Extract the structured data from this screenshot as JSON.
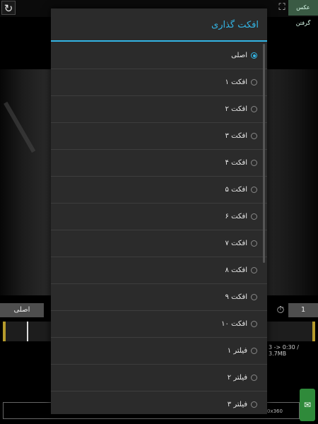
{
  "topbar": {
    "refresh_icon": "↻",
    "fullscreen_icon": "⛶",
    "photo_button": "عکس گرفتن"
  },
  "controls": {
    "original_button": "اصلی",
    "timer_icon": "⏱",
    "count_value": "1",
    "info_text": "3 -> 0:30 / 3.7MB",
    "resolution_text": "0x360"
  },
  "dialog": {
    "title": "افکت گذاری",
    "selected_index": 0,
    "options": [
      {
        "label": "اصلی"
      },
      {
        "label": "افکت ۱"
      },
      {
        "label": "افکت ۲"
      },
      {
        "label": "افکت ۳"
      },
      {
        "label": "افکت ۴"
      },
      {
        "label": "افکت ۵"
      },
      {
        "label": "افکت ۶"
      },
      {
        "label": "افکت ۷"
      },
      {
        "label": "افکت ۸"
      },
      {
        "label": "افکت ۹"
      },
      {
        "label": "افکت ۱۰"
      },
      {
        "label": "فیلتر ۱"
      },
      {
        "label": "فیلتر ۲"
      },
      {
        "label": "فیلتر ۳"
      }
    ]
  },
  "colors": {
    "accent": "#33b5e5",
    "dialog_bg": "#2b2b2b",
    "trim_handle": "#b59b2c"
  }
}
